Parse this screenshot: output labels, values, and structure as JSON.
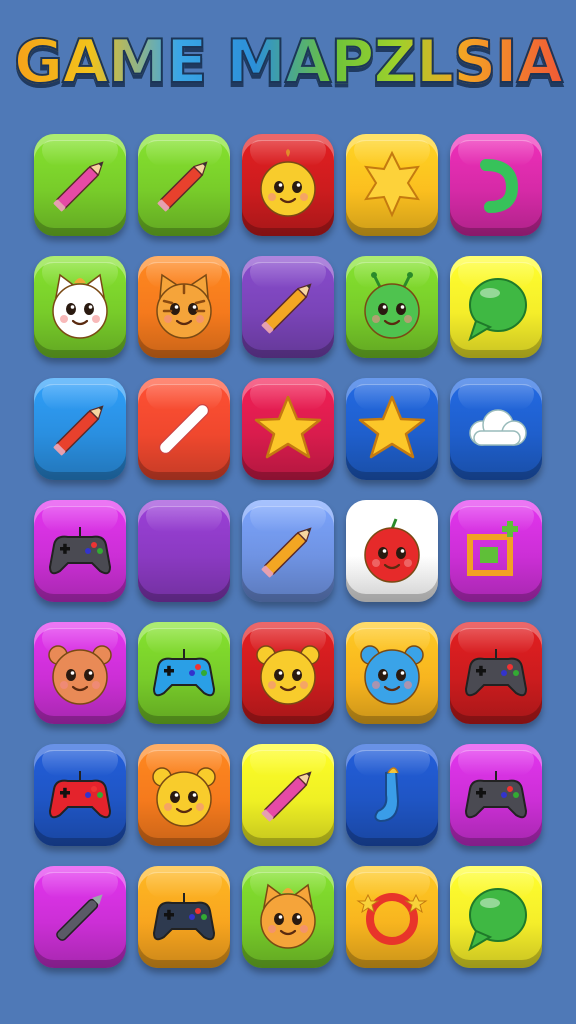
{
  "title": "GAME MAPZLSIA",
  "tiles": [
    {
      "color": "#78cc2a",
      "icon": "pencil-icon",
      "accent": "#e64aa6"
    },
    {
      "color": "#78cc2a",
      "icon": "pencil-icon",
      "accent": "#e8412d"
    },
    {
      "color": "#cc1c1e",
      "icon": "smiley-face-icon",
      "accent": "#f8cc2c"
    },
    {
      "color": "#fbbf1f",
      "icon": "star-badge-icon",
      "accent": "#fdd23a"
    },
    {
      "color": "#d62aa7",
      "icon": "hook-icon",
      "accent": "#37c25a"
    },
    {
      "color": "#78cc2a",
      "icon": "cat-face-icon",
      "accent": "#ffffff"
    },
    {
      "color": "#f57a1d",
      "icon": "tiger-face-icon",
      "accent": "#f5a43a"
    },
    {
      "color": "#7a44b8",
      "icon": "pencil-icon",
      "accent": "#f3a623"
    },
    {
      "color": "#78cc2a",
      "icon": "alien-face-icon",
      "accent": "#4fc34f"
    },
    {
      "color": "#f5ee2a",
      "icon": "speech-bubble-icon",
      "accent": "#3fb843"
    },
    {
      "color": "#2a8fe0",
      "icon": "pencil-icon",
      "accent": "#e8412d"
    },
    {
      "color": "#f0482e",
      "icon": "chalk-icon",
      "accent": "#ffffff"
    },
    {
      "color": "#d91c4d",
      "icon": "star-icon",
      "accent": "#fcc729"
    },
    {
      "color": "#1f5fcc",
      "icon": "star-icon",
      "accent": "#fcc729"
    },
    {
      "color": "#1f5fcc",
      "icon": "cloud-icon",
      "accent": "#ffffff"
    },
    {
      "color": "#cc2fd6",
      "icon": "gamepad-icon",
      "accent": "#4a4a52"
    },
    {
      "color": "#8b3ac2",
      "icon": "blank-icon",
      "accent": "#8b3ac2"
    },
    {
      "color": "#6f93e3",
      "icon": "pencil-icon",
      "accent": "#f3a623"
    },
    {
      "color": "#ffffff",
      "icon": "bomb-face-icon",
      "accent": "#e62a2a"
    },
    {
      "color": "#cc2fd6",
      "icon": "frame-icon",
      "accent": "#5fbf38"
    },
    {
      "color": "#cc2fd6",
      "icon": "bear-face-icon",
      "accent": "#e98a56"
    },
    {
      "color": "#78cc2a",
      "icon": "gamepad-icon",
      "accent": "#2a9fe6"
    },
    {
      "color": "#cc1c1e",
      "icon": "lion-face-icon",
      "accent": "#f8cc2c"
    },
    {
      "color": "#f8b51f",
      "icon": "blue-bear-face-icon",
      "accent": "#3aa3e8"
    },
    {
      "color": "#cc1c1e",
      "icon": "gamepad-icon",
      "accent": "#4a4a52"
    },
    {
      "color": "#1f55c4",
      "icon": "gamepad-icon",
      "accent": "#e4232c"
    },
    {
      "color": "#f57a1d",
      "icon": "hamster-face-icon",
      "accent": "#f8cc2c"
    },
    {
      "color": "#eff024",
      "icon": "pencil-icon",
      "accent": "#e64aa6"
    },
    {
      "color": "#1f55c4",
      "icon": "sock-icon",
      "accent": "#3a9de8"
    },
    {
      "color": "#cc2fd6",
      "icon": "gamepad-icon",
      "accent": "#4a4a52"
    },
    {
      "color": "#cc2fd6",
      "icon": "pen-icon",
      "accent": "#5a5a66"
    },
    {
      "color": "#f8a51f",
      "icon": "gamepad-icon",
      "accent": "#2e3a4f"
    },
    {
      "color": "#78cc2a",
      "icon": "cat-face-icon",
      "accent": "#f5a43a"
    },
    {
      "color": "#f8b51f",
      "icon": "ring-icon",
      "accent": "#e8342a"
    },
    {
      "color": "#f5ee2a",
      "icon": "speech-bubble-icon",
      "accent": "#3fb843"
    }
  ]
}
